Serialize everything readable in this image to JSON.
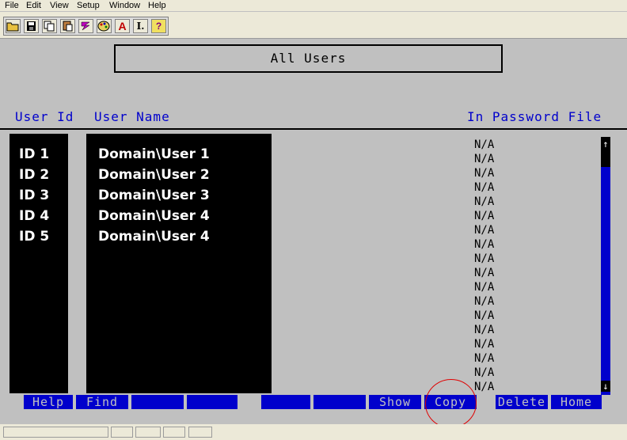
{
  "menu": [
    "File",
    "Edit",
    "View",
    "Setup",
    "Window",
    "Help"
  ],
  "toolbar_icons": [
    "open-folder-icon",
    "save-icon",
    "copy-icon",
    "paste-icon",
    "run-icon",
    "palette-icon",
    "font-icon",
    "text-cursor-icon",
    "help-icon"
  ],
  "toolbar_glyphs": [
    "",
    "",
    "",
    "",
    "",
    "",
    "A",
    "I.",
    "?"
  ],
  "screen": {
    "title": "All Users",
    "columns": {
      "user_id": "User Id",
      "user_name": "User Name",
      "in_password_file": "In Password File"
    },
    "users": [
      {
        "id": "ID 1",
        "name": "Domain\\User 1"
      },
      {
        "id": "ID 2",
        "name": "Domain\\User 2"
      },
      {
        "id": "ID 3",
        "name": "Domain\\User 3"
      },
      {
        "id": "ID 4",
        "name": "Domain\\User 4"
      },
      {
        "id": "ID 5",
        "name": "Domain\\User 4"
      }
    ],
    "password_column": [
      "N/A",
      "N/A",
      "N/A",
      "N/A",
      "N/A",
      "N/A",
      "N/A",
      "N/A",
      "N/A",
      "N/A",
      "N/A",
      "N/A",
      "N/A",
      "N/A",
      "N/A",
      "N/A",
      "N/A",
      "N/A"
    ],
    "scroll_up": "↑",
    "scroll_down": "↓"
  },
  "function_keys": [
    "Help",
    "Find",
    "",
    "",
    "",
    "",
    "Show",
    "Copy",
    "Delete",
    "Home"
  ],
  "colors": {
    "background": "#c0c0c0",
    "accent_blue": "#0000cc",
    "annotation": "#e00000"
  }
}
